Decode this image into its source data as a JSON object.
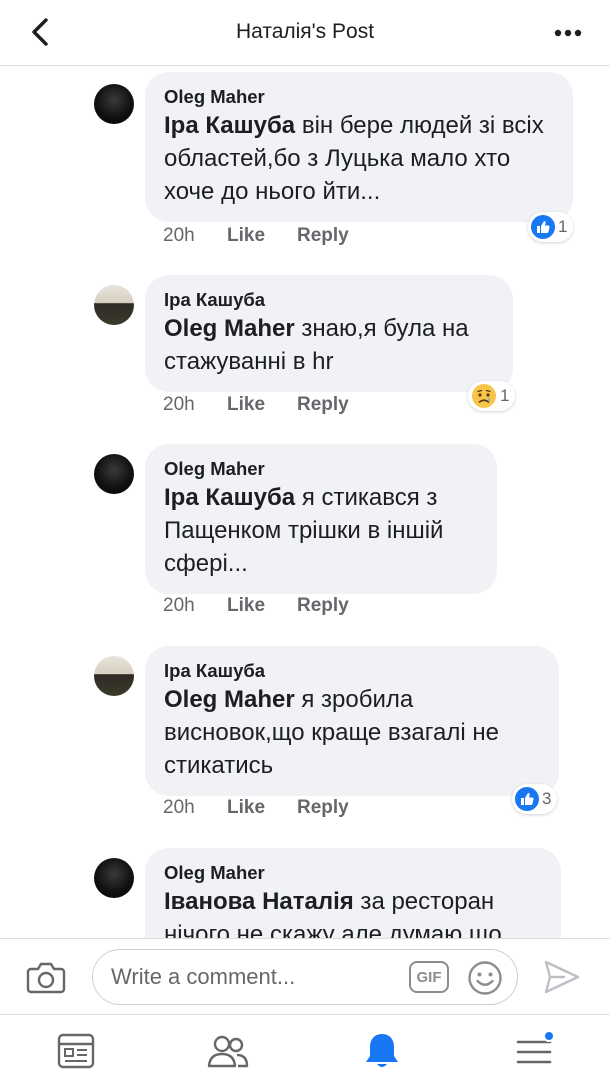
{
  "header": {
    "title": "Наталія's Post",
    "back_icon": "chevron-left-icon",
    "more_icon": "more-dots-icon"
  },
  "comments": [
    {
      "author": "Oleg Maher",
      "mention": "Іра Кашуба",
      "text": " він бере людей зі всіх областей,бо з Луцька мало хто хоче до нього йти...",
      "time": "20h",
      "like_label": "Like",
      "reply_label": "Reply",
      "reaction": {
        "type": "like",
        "count": "1"
      }
    },
    {
      "author": "Іра Кашуба",
      "mention": "Oleg Maher",
      "text": " знаю,я була на стажуванні в hr",
      "time": "20h",
      "like_label": "Like",
      "reply_label": "Reply",
      "reaction": {
        "type": "sad",
        "count": "1"
      }
    },
    {
      "author": "Oleg Maher",
      "mention": "Іра Кашуба",
      "text": " я стикався з Пащенком трішки в іншій сфері...",
      "time": "20h",
      "like_label": "Like",
      "reply_label": "Reply"
    },
    {
      "author": "Іра Кашуба",
      "mention": "Oleg Maher",
      "text": " я зробила висновок,що краще взагалі не стикатись",
      "time": "20h",
      "like_label": "Like",
      "reply_label": "Reply",
      "reaction": {
        "type": "like",
        "count": "3"
      }
    },
    {
      "author": "Oleg Maher",
      "mention": "Іванова Наталія",
      "text": "  за ресторан нічого не скажу але думаю що"
    }
  ],
  "composer": {
    "placeholder": "Write a comment...",
    "gif_label": "GIF",
    "camera_icon": "camera-icon",
    "emoji_icon": "emoji-icon",
    "send_icon": "send-icon"
  },
  "bottom_nav": {
    "items": [
      "news-feed-icon",
      "friends-icon",
      "notifications-bell-icon",
      "menu-icon"
    ],
    "active": "notifications-bell-icon"
  },
  "colors": {
    "accent": "#1877f2",
    "bubble": "#f0f2f5",
    "secondary_text": "#65676b"
  }
}
